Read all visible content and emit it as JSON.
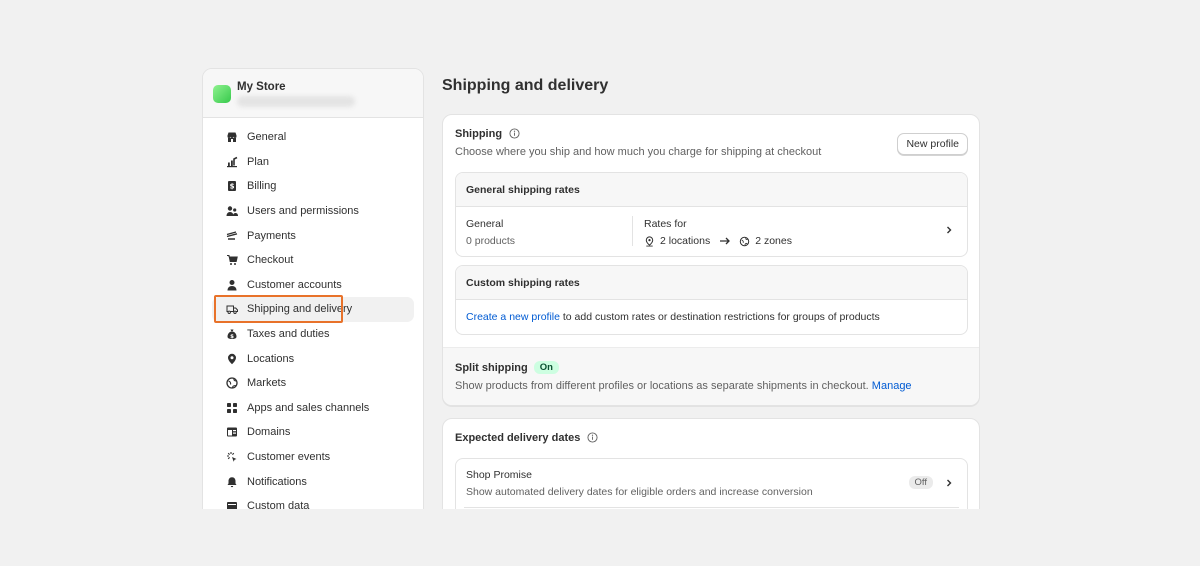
{
  "store": {
    "name": "My Store",
    "logo_color": "#4ad66a"
  },
  "sidebar": {
    "items": [
      {
        "label": "General",
        "icon": "store-icon"
      },
      {
        "label": "Plan",
        "icon": "chart-icon"
      },
      {
        "label": "Billing",
        "icon": "receipt-icon"
      },
      {
        "label": "Users and permissions",
        "icon": "users-icon"
      },
      {
        "label": "Payments",
        "icon": "payment-icon"
      },
      {
        "label": "Checkout",
        "icon": "cart-icon"
      },
      {
        "label": "Customer accounts",
        "icon": "person-icon"
      },
      {
        "label": "Shipping and delivery",
        "icon": "truck-icon",
        "active": true
      },
      {
        "label": "Taxes and duties",
        "icon": "tax-icon"
      },
      {
        "label": "Locations",
        "icon": "location-icon"
      },
      {
        "label": "Markets",
        "icon": "globe-icon"
      },
      {
        "label": "Apps and sales channels",
        "icon": "apps-icon"
      },
      {
        "label": "Domains",
        "icon": "domain-icon"
      },
      {
        "label": "Customer events",
        "icon": "cursor-icon"
      },
      {
        "label": "Notifications",
        "icon": "bell-icon"
      },
      {
        "label": "Custom data",
        "icon": "data-icon"
      }
    ]
  },
  "page": {
    "title": "Shipping and delivery"
  },
  "shipping": {
    "title": "Shipping",
    "description": "Choose where you ship and how much you charge for shipping at checkout",
    "new_profile_label": "New profile",
    "general_rates": {
      "header": "General shipping rates",
      "profile_name": "General",
      "products": "0 products",
      "rates_for_label": "Rates for",
      "locations": "2 locations",
      "zones": "2 zones"
    },
    "custom_rates": {
      "header": "Custom shipping rates",
      "link_text": "Create a new profile",
      "rest_text": " to add custom rates or destination restrictions for groups of products"
    },
    "split": {
      "title": "Split shipping",
      "status": "On",
      "description": "Show products from different profiles or locations as separate shipments in checkout.",
      "manage_label": "Manage"
    }
  },
  "delivery": {
    "title": "Expected delivery dates",
    "shop_promise": {
      "title": "Shop Promise",
      "description": "Show automated delivery dates for eligible orders and increase conversion",
      "status": "Off"
    }
  },
  "colors": {
    "accent_link": "#005bd3",
    "highlight_box": "#e8722a",
    "badge_on_bg": "#cdfee1"
  }
}
